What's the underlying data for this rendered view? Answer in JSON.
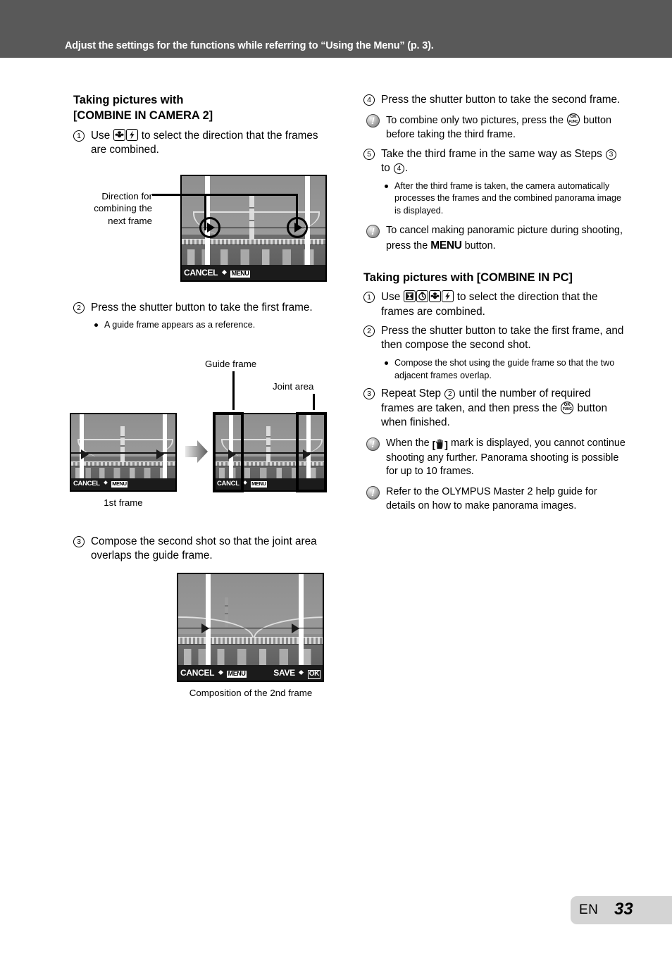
{
  "header": {
    "banner_text": "Adjust the settings for the functions while referring to “Using the Menu” (p. 3).",
    "band_color": "#595959"
  },
  "left_column": {
    "section_title_line1": "Taking pictures with",
    "section_title_line2": "[COMBINE IN CAMERA 2]",
    "steps": [
      {
        "number": "1",
        "text_before_icons": "Use",
        "icons": [
          "macro-button-icon",
          "flash-button-icon"
        ],
        "text_after_icons": "to select the direction that the frames are combined."
      },
      {
        "number": "2",
        "text": "Press the shutter button to take the first frame."
      },
      {
        "number": "3",
        "text": "Compose the second shot so that the joint area overlaps the guide frame."
      }
    ],
    "bullets": [
      "A guide frame appears as a reference."
    ],
    "figure1": {
      "callout_label_lines": [
        "Direction for",
        "combining the",
        "next frame"
      ],
      "osd_cancel": "CANCEL",
      "osd_menu": "MENU"
    },
    "figure2": {
      "label_guide_frame": "Guide frame",
      "label_joint_area": "Joint area",
      "caption_first": "1st frame",
      "osd_cancel": "CANCEL",
      "osd_cancel_clipped": "CANC",
      "osd_cancel_tail": "L",
      "osd_menu": "MENU"
    },
    "figure3": {
      "caption": "Composition of the 2nd frame",
      "osd_cancel": "CANCEL",
      "osd_menu": "MENU",
      "osd_save": "SAVE",
      "osd_ok": "OK"
    }
  },
  "right_column": {
    "steps_camera2": [
      {
        "number": "4",
        "text": "Press the shutter button to take the second frame."
      },
      {
        "number": "5",
        "text_part1": "Take the third frame in the same way as Steps",
        "ref1": "3",
        "text_mid": "to",
        "ref2": "4",
        "text_end": "."
      }
    ],
    "notes_camera2": [
      {
        "text_part1": "To combine only two pictures, press the",
        "icon": "ok-func-button-icon",
        "text_part2": "button before taking the third frame."
      },
      {
        "text_part1": "To cancel making panoramic picture during shooting, press the",
        "emphasis": "MENU",
        "text_part2": "button."
      }
    ],
    "bullets_camera2": [
      "After the third frame is taken, the camera automatically processes the frames and the combined panorama image is displayed."
    ],
    "section_title_pc": "Taking pictures with [COMBINE IN PC]",
    "steps_pc": [
      {
        "number": "1",
        "text_before_icons": "Use",
        "icons": [
          "exposure-compensation-button-icon",
          "self-timer-button-icon",
          "macro-button-icon",
          "flash-button-icon"
        ],
        "text_after_icons": "to select the direction that the frames are combined."
      },
      {
        "number": "2",
        "text": "Press the shutter button to take the first frame, and then compose the second shot."
      },
      {
        "number": "3",
        "text_part1": "Repeat Step",
        "ref": "2",
        "text_part2": "until the number of required frames are taken, and then press the",
        "icon": "ok-func-button-icon",
        "text_part3": "button when finished."
      }
    ],
    "bullets_pc": [
      "Compose the shot using the guide frame so that the two adjacent frames overlap."
    ],
    "notes_pc": [
      {
        "text_part1": "When the",
        "icon": "hand-stop-mark-icon",
        "text_part2": "mark is displayed, you cannot continue shooting any further. Panorama shooting is possible for up to 10 frames."
      },
      {
        "text": "Refer to the OLYMPUS Master 2 help guide for details on how to make panorama images."
      }
    ]
  },
  "footer": {
    "language": "EN",
    "page_number": "33",
    "chip_color": "#d4d4d4"
  }
}
